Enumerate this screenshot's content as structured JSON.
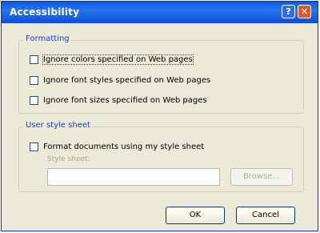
{
  "window": {
    "title": "Accessibility",
    "help_button": "?",
    "close_button": "✕"
  },
  "formatting": {
    "legend": "Formatting",
    "options": [
      {
        "label": "Ignore colors specified on Web pages",
        "checked": false
      },
      {
        "label": "Ignore font styles specified on Web pages",
        "checked": false
      },
      {
        "label": "Ignore font sizes specified on Web pages",
        "checked": false
      }
    ]
  },
  "user_style_sheet": {
    "legend": "User style sheet",
    "format_label": "Format documents using my style sheet",
    "format_checked": false,
    "style_sheet_label": "Style sheet:",
    "style_sheet_value": "",
    "browse_label": "Browse..."
  },
  "buttons": {
    "ok": "OK",
    "cancel": "Cancel"
  }
}
